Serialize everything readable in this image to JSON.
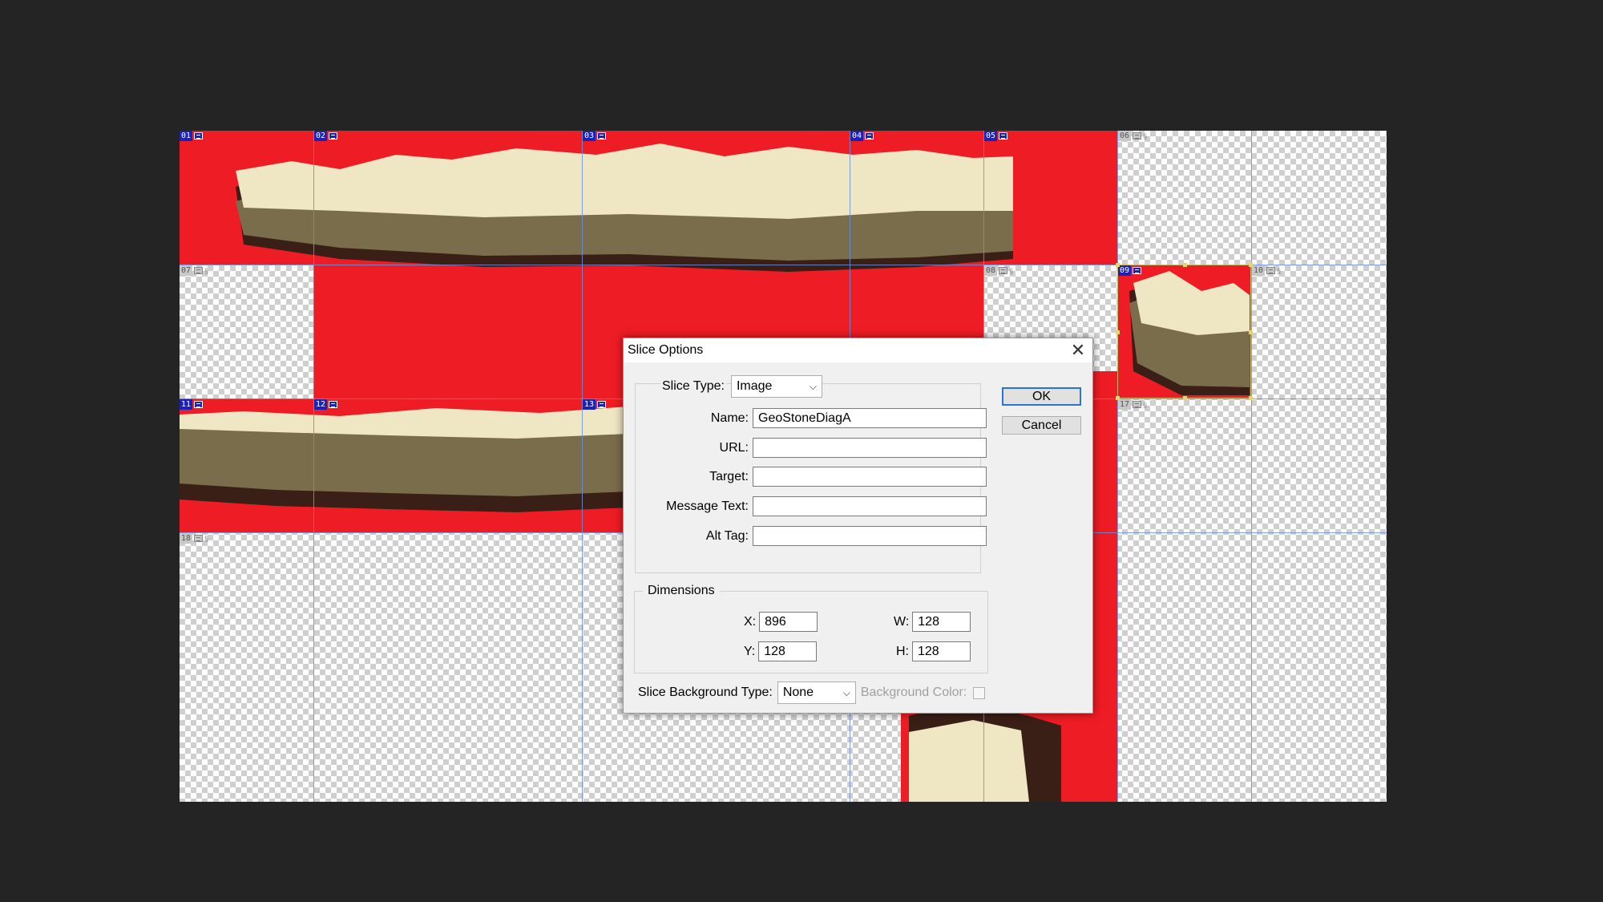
{
  "slices": [
    {
      "num": "01",
      "kind": "user"
    },
    {
      "num": "02",
      "kind": "user"
    },
    {
      "num": "03",
      "kind": "user"
    },
    {
      "num": "04",
      "kind": "user"
    },
    {
      "num": "05",
      "kind": "user"
    },
    {
      "num": "06",
      "kind": "auto"
    },
    {
      "num": "07",
      "kind": "auto"
    },
    {
      "num": "08",
      "kind": "auto"
    },
    {
      "num": "09",
      "kind": "user"
    },
    {
      "num": "10",
      "kind": "auto"
    },
    {
      "num": "11",
      "kind": "user"
    },
    {
      "num": "12",
      "kind": "user"
    },
    {
      "num": "13",
      "kind": "user"
    },
    {
      "num": "17",
      "kind": "auto"
    },
    {
      "num": "18",
      "kind": "auto"
    }
  ],
  "colors": {
    "slice_fill": "#ee1c25",
    "stone_light": "#efe6c3",
    "stone_dark": "#7a6d4c",
    "shadow": "#3a1f16",
    "accent": "#2b74cf"
  },
  "dialog": {
    "title": "Slice Options",
    "close_icon": "close-icon",
    "slice_type_label": "Slice Type:",
    "slice_type_value": "Image",
    "name_label": "Name:",
    "name_value": "GeoStoneDiagA",
    "url_label": "URL:",
    "url_value": "",
    "target_label": "Target:",
    "target_value": "",
    "message_label": "Message Text:",
    "message_value": "",
    "alt_label": "Alt Tag:",
    "alt_value": "",
    "dimensions_label": "Dimensions",
    "x_label": "X:",
    "x_value": "896",
    "y_label": "Y:",
    "y_value": "128",
    "w_label": "W:",
    "w_value": "128",
    "h_label": "H:",
    "h_value": "128",
    "bg_type_label": "Slice Background Type:",
    "bg_type_value": "None",
    "bg_color_label": "Background Color:",
    "ok_label": "OK",
    "cancel_label": "Cancel"
  }
}
